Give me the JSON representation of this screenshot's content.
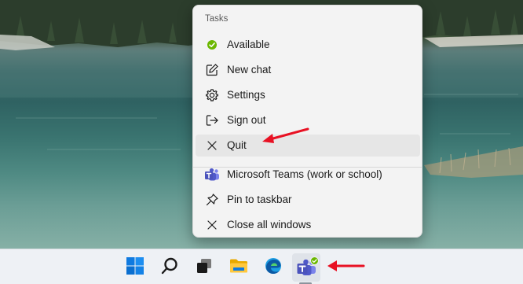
{
  "menu": {
    "header": "Tasks",
    "items": [
      {
        "label": "Available",
        "icon": "available-status-icon"
      },
      {
        "label": "New chat",
        "icon": "new-chat-icon"
      },
      {
        "label": "Settings",
        "icon": "gear-icon"
      },
      {
        "label": "Sign out",
        "icon": "sign-out-icon"
      },
      {
        "label": "Quit",
        "icon": "close-icon",
        "highlighted": true
      }
    ],
    "app_items": [
      {
        "label": "Microsoft Teams (work or school)",
        "icon": "teams-icon"
      },
      {
        "label": "Pin to taskbar",
        "icon": "pin-icon"
      },
      {
        "label": "Close all windows",
        "icon": "close-icon"
      }
    ]
  },
  "taskbar": {
    "apps": [
      {
        "name": "Start",
        "icon": "windows-start-icon"
      },
      {
        "name": "Search",
        "icon": "search-icon"
      },
      {
        "name": "Task View",
        "icon": "task-view-icon"
      },
      {
        "name": "File Explorer",
        "icon": "folder-icon"
      },
      {
        "name": "Microsoft Edge",
        "icon": "edge-icon"
      },
      {
        "name": "Microsoft Teams",
        "icon": "teams-icon",
        "active": true,
        "status": "available"
      }
    ]
  },
  "colors": {
    "available_green": "#6bb700",
    "teams_purple": "#5059c9",
    "annotation_red": "#e81123",
    "windows_blue": "#0078d4"
  },
  "annotations": [
    "red-arrow-to-quit",
    "red-arrow-to-teams-taskbar-icon"
  ]
}
